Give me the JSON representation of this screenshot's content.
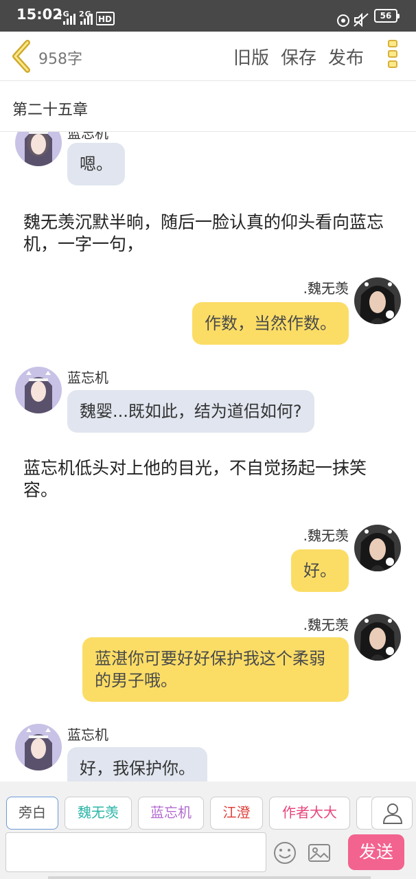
{
  "status_bar": {
    "time": "15:02",
    "signal_1": "4G",
    "signal_2": "2G",
    "hd": "HD",
    "battery": "56"
  },
  "header": {
    "word_count": "958字",
    "old_version": "旧版",
    "save": "保存",
    "publish": "发布"
  },
  "chapter_title": "第二十五章",
  "messages": [
    {
      "type": "left",
      "name": "蓝忘机",
      "text": "嗯。"
    },
    {
      "type": "narration",
      "text": "魏无羡沉默半晌，随后一脸认真的仰头看向蓝忘机，一字一句，"
    },
    {
      "type": "right",
      "name": ".魏无羡",
      "text": "作数，当然作数。"
    },
    {
      "type": "left",
      "name": "蓝忘机",
      "text": "魏婴...既如此，结为道侣如何?"
    },
    {
      "type": "narration",
      "text": "蓝忘机低头对上他的目光，不自觉扬起一抹笑容。"
    },
    {
      "type": "right",
      "name": ".魏无羡",
      "text": "好。"
    },
    {
      "type": "right",
      "name": ".魏无羡",
      "text": "蓝湛你可要好好保护我这个柔弱的男子哦。"
    },
    {
      "type": "left",
      "name": "蓝忘机",
      "text": "好，我保护你。"
    }
  ],
  "roles": [
    {
      "label": "旁白",
      "color": "#555555"
    },
    {
      "label": "魏无羡",
      "color": "#2bb5a8"
    },
    {
      "label": "蓝忘机",
      "color": "#b36ad1"
    },
    {
      "label": "江澄",
      "color": "#e0413b"
    },
    {
      "label": "作者大大",
      "color": "#e8457a"
    }
  ],
  "input": {
    "placeholder": "",
    "send_label": "发送"
  },
  "icons": {
    "back": "chevron-left-icon",
    "menu": "more-icon",
    "user": "user-icon",
    "emoji": "emoji-icon",
    "image": "image-icon"
  },
  "colors": {
    "accent_yellow": "#fbdd66",
    "left_bubble": "#e0e5ef",
    "send_button": "#f2638f"
  }
}
